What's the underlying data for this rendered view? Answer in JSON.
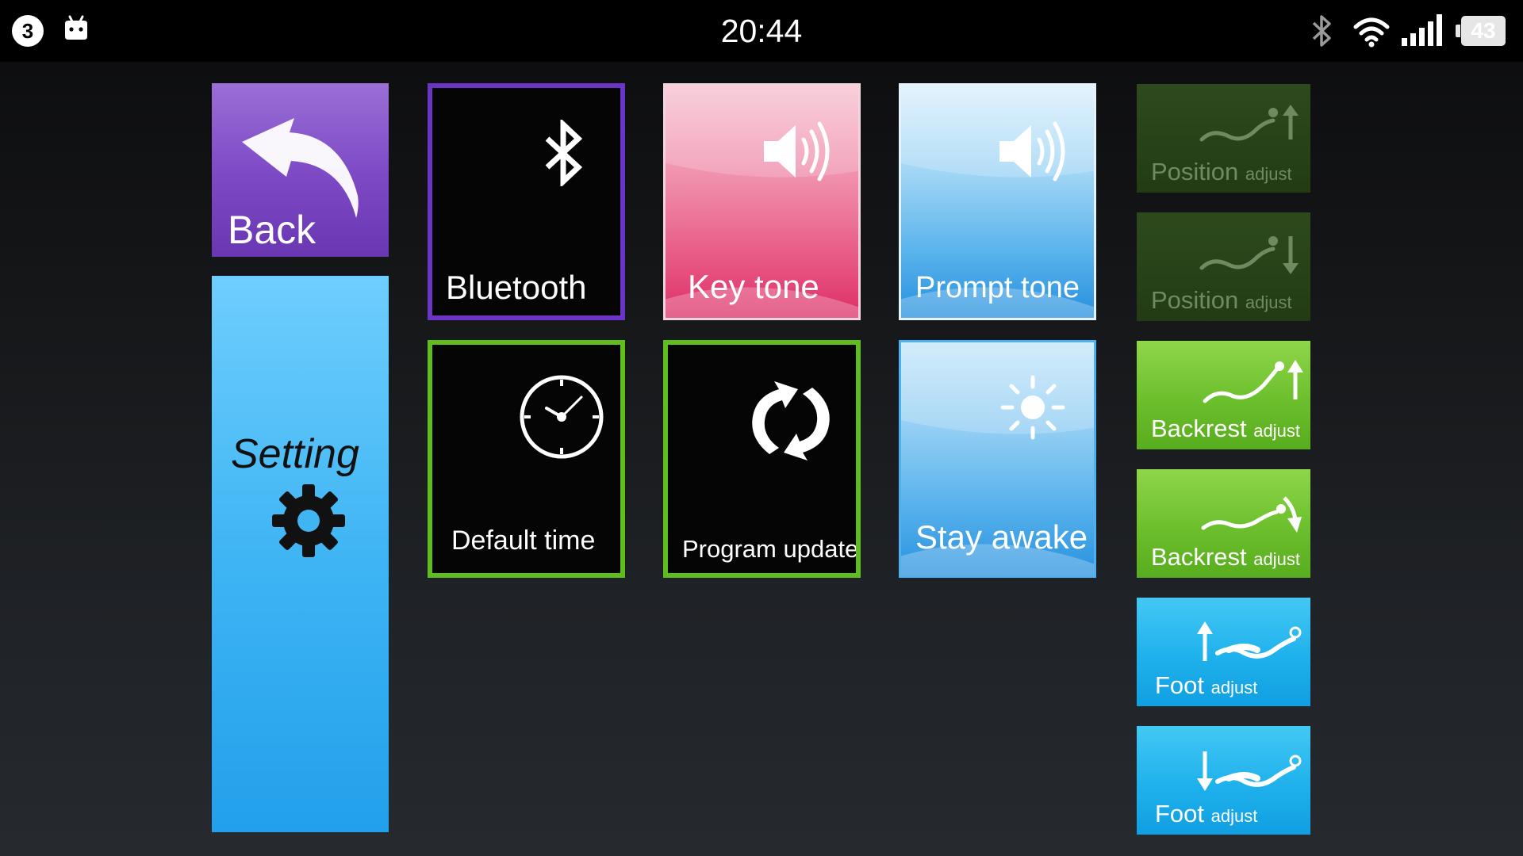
{
  "status_bar": {
    "notification_count": "3",
    "time": "20:44",
    "battery_level": "43",
    "icons": [
      "android-icon",
      "bluetooth-icon",
      "wifi-icon",
      "signal-icon",
      "battery-icon"
    ]
  },
  "tiles": {
    "back": "Back",
    "setting": "Setting",
    "bluetooth": "Bluetooth",
    "key_tone": "Key tone",
    "prompt_tone": "Prompt tone",
    "default_time": "Default time",
    "program_update": "Program update",
    "stay_awake": "Stay awake"
  },
  "side_buttons": [
    {
      "title": "Position",
      "sub": "adjust",
      "state": "disabled"
    },
    {
      "title": "Position",
      "sub": "adjust",
      "state": "disabled"
    },
    {
      "title": "Backrest",
      "sub": "adjust",
      "state": "enabled"
    },
    {
      "title": "Backrest",
      "sub": "adjust",
      "state": "enabled"
    },
    {
      "title": "Foot",
      "sub": "adjust",
      "state": "enabled"
    },
    {
      "title": "Foot",
      "sub": "adjust",
      "state": "enabled"
    }
  ],
  "colors": {
    "back_purple": "#7c48c4",
    "setting_blue": "#3fb5f4",
    "outline_purple": "#6a35c4",
    "outline_green": "#5fbd1d",
    "key_tone_pink": "#e6507f",
    "tone_blue": "#5db5ec",
    "adjust_green": "#6cbf2c",
    "adjust_disabled": "#223b14",
    "foot_cyan": "#1fb1ec"
  }
}
